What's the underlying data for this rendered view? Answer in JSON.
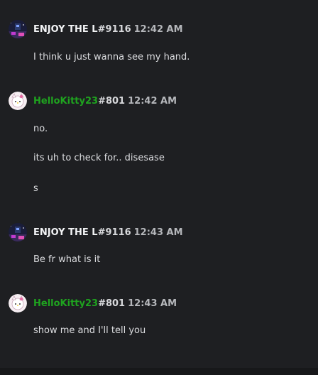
{
  "messages": [
    {
      "username": "ENJOY THE L",
      "discriminator": "#9116",
      "time": "12:42 AM",
      "avatar_icon": "pixel-art-avatar-icon",
      "lines": [
        "I think u just wanna see my hand."
      ]
    },
    {
      "username": "HelloKitty23",
      "discriminator": "#801",
      "time": "12:42 AM",
      "avatar_icon": "hello-kitty-avatar-icon",
      "username_color": "#1fa31f",
      "lines": [
        "no.",
        "its uh to check for.. disesase",
        "s"
      ]
    },
    {
      "username": "ENJOY THE L",
      "discriminator": "#9116",
      "time": "12:43 AM",
      "avatar_icon": "pixel-art-avatar-icon",
      "lines": [
        "Be fr what is it"
      ]
    },
    {
      "username": "HelloKitty23",
      "discriminator": "#801",
      "time": "12:43 AM",
      "avatar_icon": "hello-kitty-avatar-icon",
      "username_color": "#1fa31f",
      "lines": [
        "show me and I'll tell you"
      ]
    }
  ],
  "colors": {
    "background": "#1e1f22",
    "text": "#dcdde0",
    "timestamp": "#b5b7bb"
  }
}
